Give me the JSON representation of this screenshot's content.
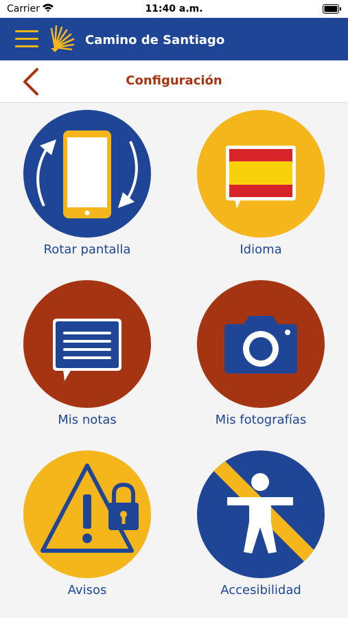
{
  "status_bar": {
    "carrier": "Carrier",
    "time": "11:40 a.m."
  },
  "app_bar": {
    "title": "Camino de Santiago"
  },
  "sub_bar": {
    "title": "Configuración"
  },
  "colors": {
    "brand_blue": "#1f4597",
    "brand_yellow": "#f4b61a",
    "brand_red": "#a53512",
    "flag_red": "#d7232a",
    "flag_yellow": "#f9d10b"
  },
  "menu": {
    "items": [
      {
        "label": "Rotar pantalla",
        "icon": "rotate-phone-icon"
      },
      {
        "label": "Idioma",
        "icon": "spanish-flag-icon"
      },
      {
        "label": "Mis notas",
        "icon": "notes-icon"
      },
      {
        "label": "Mis fotografías",
        "icon": "camera-icon"
      },
      {
        "label": "Avisos",
        "icon": "warning-lock-icon"
      },
      {
        "label": "Accesibilidad",
        "icon": "accessibility-icon"
      }
    ]
  }
}
